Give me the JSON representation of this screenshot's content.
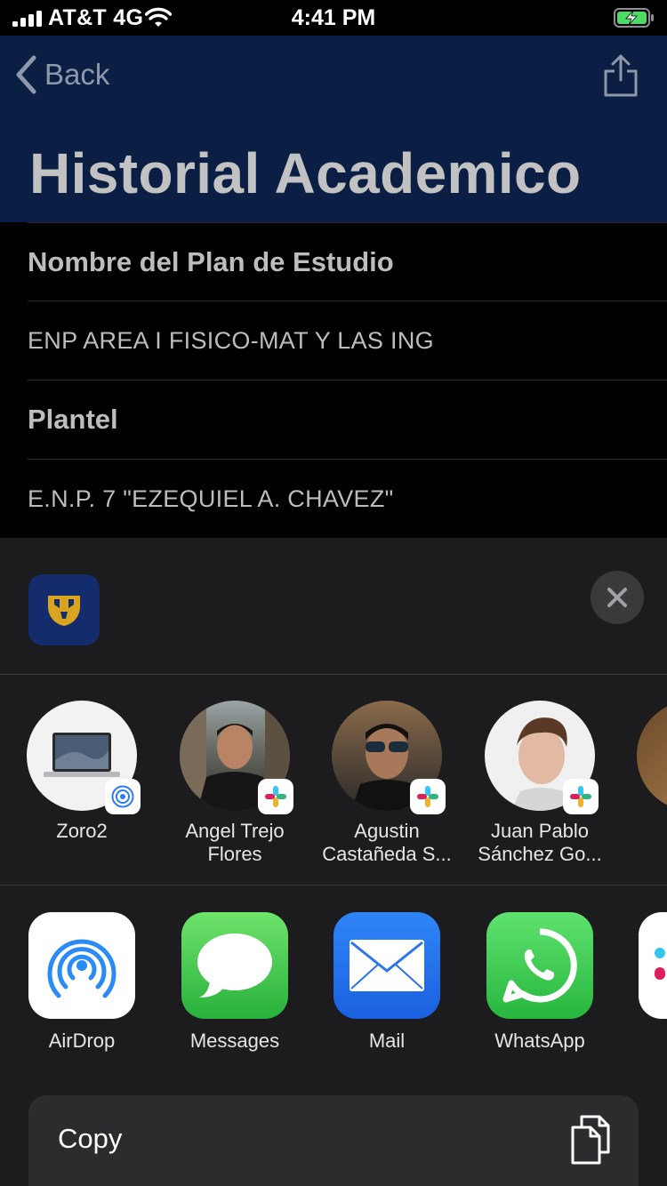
{
  "status_bar": {
    "carrier": "AT&T 4G",
    "time": "4:41 PM",
    "icons": [
      "signal-icon",
      "wifi-icon",
      "battery-charging-icon"
    ]
  },
  "nav": {
    "back_label": "Back",
    "title": "Historial Academico",
    "icons": [
      "chevron-left-icon",
      "share-icon"
    ]
  },
  "list": [
    {
      "label": "Nombre del Plan de Estudio"
    },
    {
      "label": "ENP AREA I FISICO-MAT Y LAS ING"
    },
    {
      "label": "Plantel"
    },
    {
      "label": "E.N.P. 7 \"EZEQUIEL A. CHAVEZ\""
    }
  ],
  "share_sheet": {
    "app_icon": "pumas-logo-icon",
    "close_icon": "close-icon",
    "people": [
      {
        "name": "Zoro2",
        "badge": "airdrop-badge-icon"
      },
      {
        "name": "Angel Trejo Flores",
        "badge": "slack-badge-icon"
      },
      {
        "name": "Agustin Castañeda S...",
        "badge": "slack-badge-icon"
      },
      {
        "name": "Juan Pablo Sánchez Go...",
        "badge": "slack-badge-icon"
      }
    ],
    "apps": [
      {
        "label": "AirDrop",
        "icon": "airdrop-icon"
      },
      {
        "label": "Messages",
        "icon": "messages-icon"
      },
      {
        "label": "Mail",
        "icon": "mail-icon"
      },
      {
        "label": "WhatsApp",
        "icon": "whatsapp-icon"
      }
    ],
    "copy_label": "Copy",
    "copy_icon": "copy-icon"
  },
  "colors": {
    "nav_background": "#0b1f45",
    "sheet_background": "#1c1c1e",
    "battery_green": "#4cd964"
  }
}
